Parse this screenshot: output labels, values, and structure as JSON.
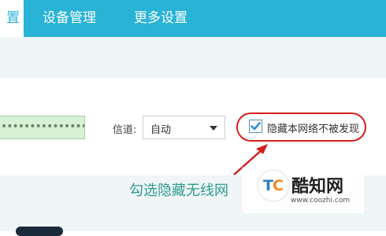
{
  "nav": {
    "active_tab": "置",
    "tabs": [
      "设备管理",
      "更多设置"
    ]
  },
  "wifi": {
    "password_mask": "••••••••••••••••",
    "channel_label": "信道:",
    "channel_value": "自动",
    "hide_network_label": "隐藏本网络不被发现",
    "hide_network_checked": true
  },
  "annotation": {
    "text": "勾选隐藏无线网"
  },
  "watermark": {
    "logo_text": "TC",
    "name": "酷知网",
    "url": "www.coozhi.com"
  },
  "colors": {
    "header": "#29b3d6",
    "highlight": "#d41f1f",
    "annotation": "#2f9c8d"
  }
}
